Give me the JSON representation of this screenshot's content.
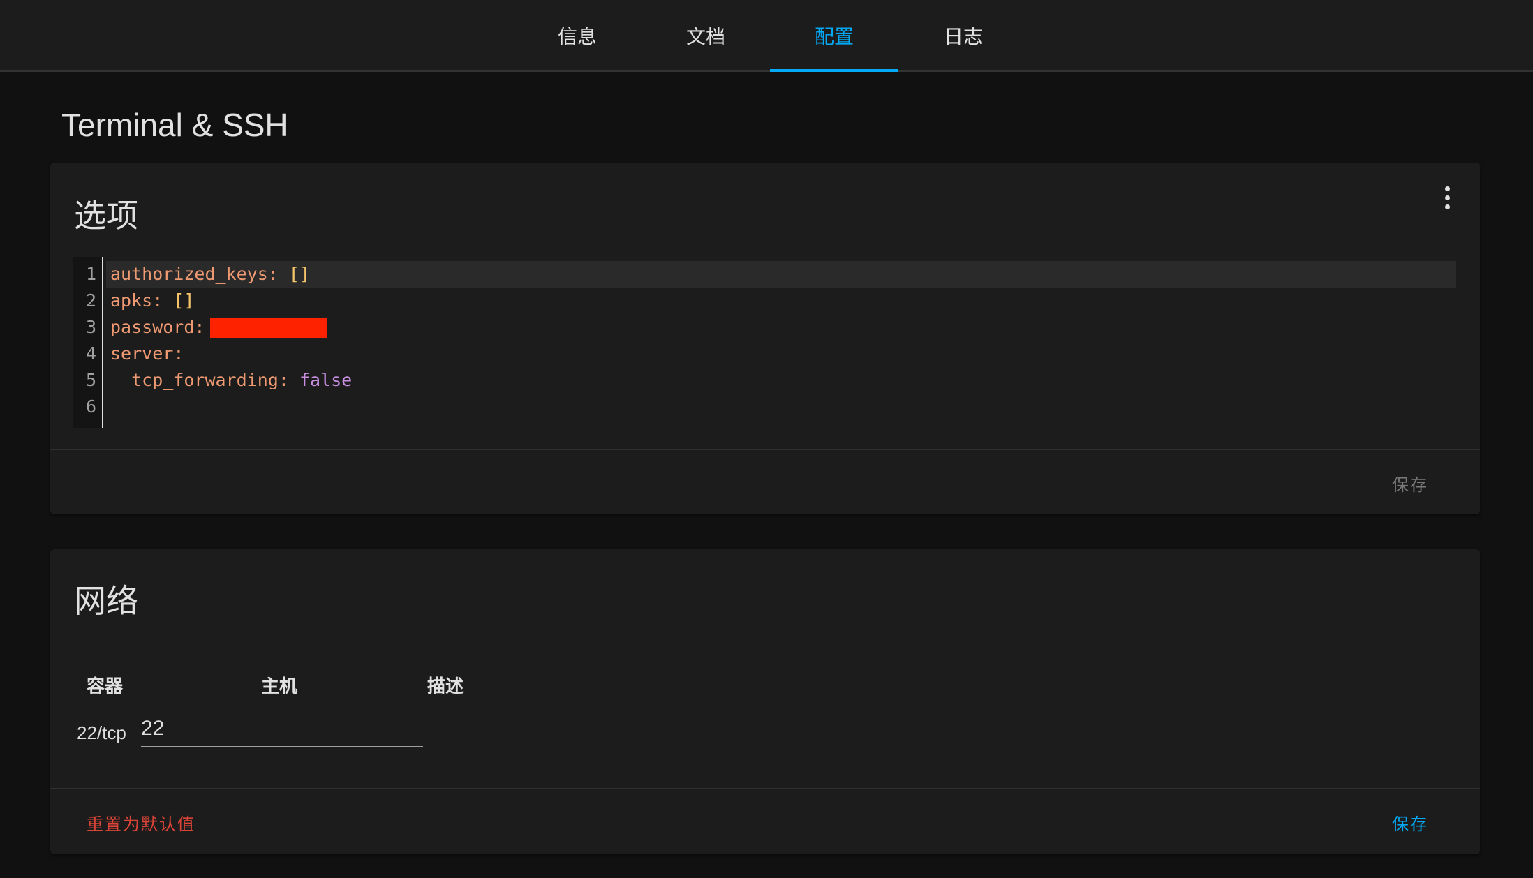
{
  "tabs": [
    {
      "label": "信息"
    },
    {
      "label": "文档"
    },
    {
      "label": "配置"
    },
    {
      "label": "日志"
    }
  ],
  "page": {
    "title": "Terminal & SSH"
  },
  "options": {
    "title": "选项",
    "line_numbers": [
      "1",
      "2",
      "3",
      "4",
      "5",
      "6"
    ],
    "code": {
      "l1_key": "authorized_keys",
      "l1_sep": ": ",
      "l1_val": "[]",
      "l2_key": "apks",
      "l2_sep": ": ",
      "l2_val": "[]",
      "l3_key": "password",
      "l3_sep": ":",
      "l4_key": "server",
      "l4_sep": ":",
      "l5_indent": "  ",
      "l5_key": "tcp_forwarding",
      "l5_sep": ": ",
      "l5_val": "false"
    },
    "save_label": "保存"
  },
  "network": {
    "title": "网络",
    "headers": {
      "container": "容器",
      "host": "主机",
      "description": "描述"
    },
    "rows": [
      {
        "container": "22/tcp",
        "host": "22"
      }
    ],
    "reset_label": "重置为默认值",
    "save_label": "保存"
  },
  "colors": {
    "accent": "#03a9f4",
    "danger": "#db4437",
    "redacted": "#ff2200"
  }
}
